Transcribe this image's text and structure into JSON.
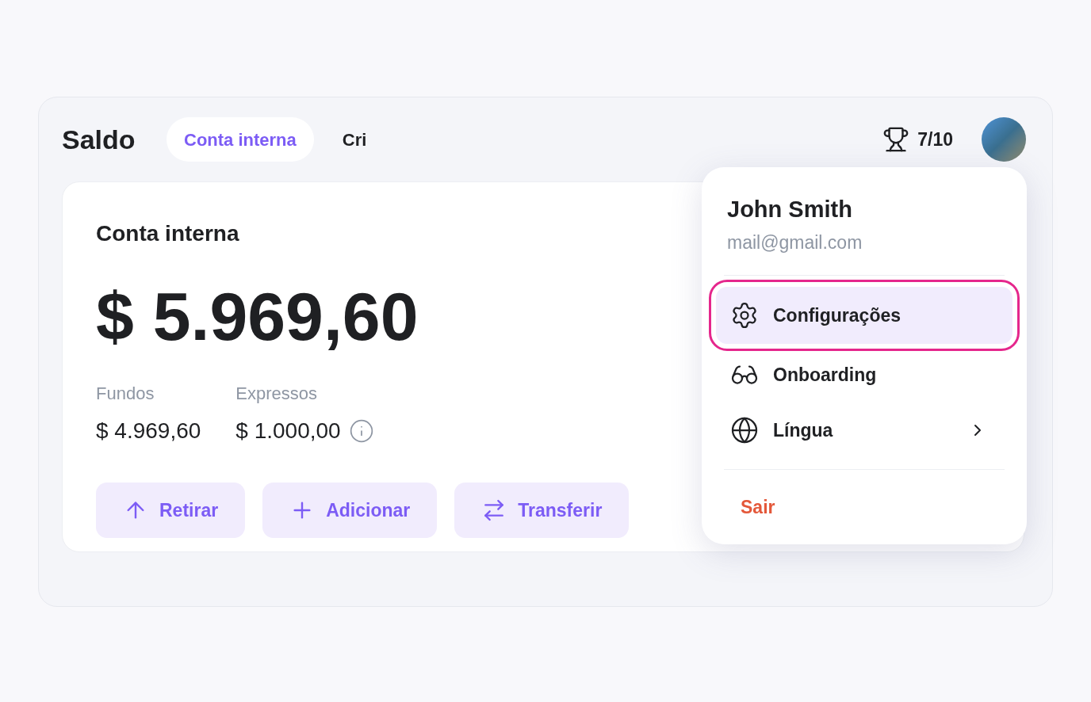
{
  "header": {
    "title": "Saldo",
    "tabs": [
      {
        "label": "Conta interna",
        "selected": true
      },
      {
        "label": "Cri",
        "selected": false
      }
    ],
    "score": "7/10"
  },
  "card": {
    "title": "Conta interna",
    "balance": "$ 5.969,60",
    "stats": [
      {
        "label": "Fundos",
        "value": "$ 4.969,60",
        "info": false
      },
      {
        "label": "Expressos",
        "value": "$ 1.000,00",
        "info": true
      }
    ],
    "actions": [
      "Retirar",
      "Adicionar",
      "Transferir"
    ]
  },
  "menu": {
    "name": "John Smith",
    "email": "mail@gmail.com",
    "items": [
      {
        "label": "Configurações",
        "selected": true,
        "submenu": false
      },
      {
        "label": "Onboarding",
        "selected": false,
        "submenu": false
      },
      {
        "label": "Língua",
        "selected": false,
        "submenu": true
      }
    ],
    "logout": "Sair"
  }
}
